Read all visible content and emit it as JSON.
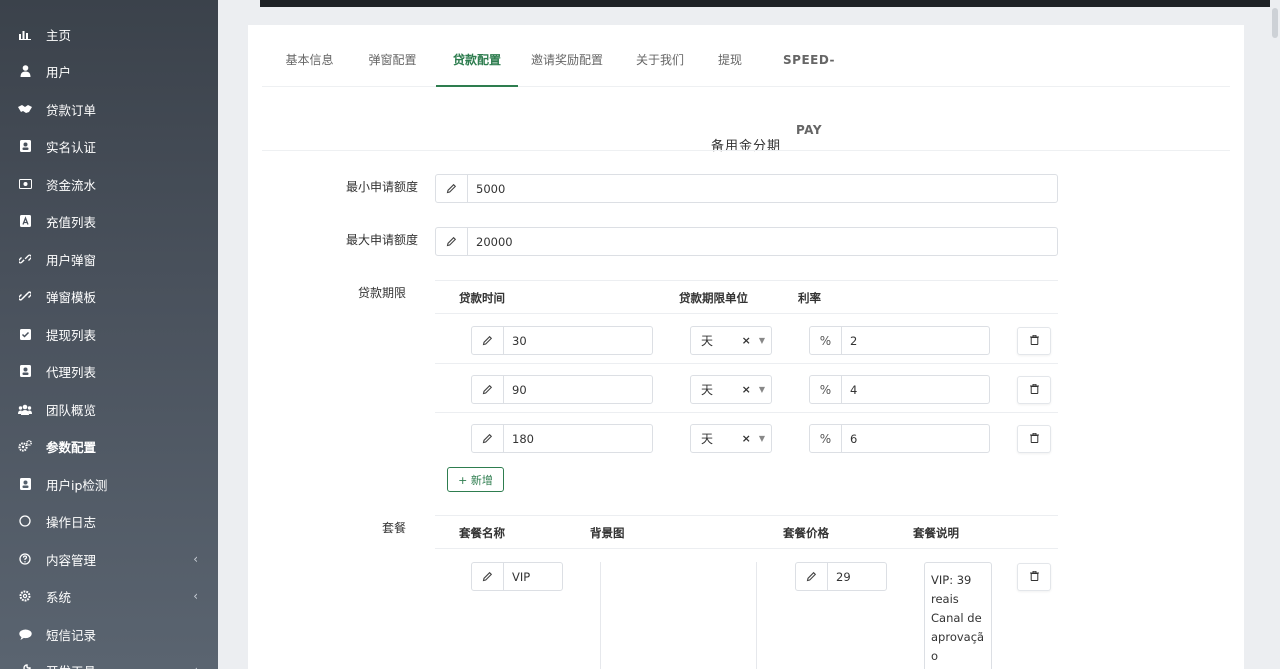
{
  "sidebar": {
    "items": [
      {
        "label": "主页",
        "icon": "bar-chart-icon"
      },
      {
        "label": "用户",
        "icon": "user-icon"
      },
      {
        "label": "贷款订单",
        "icon": "handshake-icon"
      },
      {
        "label": "实名认证",
        "icon": "id-card-icon"
      },
      {
        "label": "资金流水",
        "icon": "money-icon"
      },
      {
        "label": "充值列表",
        "icon": "app-store-icon"
      },
      {
        "label": "用户弹窗",
        "icon": "link-icon"
      },
      {
        "label": "弹窗模板",
        "icon": "link-icon"
      },
      {
        "label": "提现列表",
        "icon": "checkbox-icon"
      },
      {
        "label": "代理列表",
        "icon": "id-card-icon"
      },
      {
        "label": "团队概览",
        "icon": "users-icon"
      },
      {
        "label": "参数配置",
        "icon": "cogs-icon"
      },
      {
        "label": "用户ip检测",
        "icon": "id-card-icon"
      },
      {
        "label": "操作日志",
        "icon": "circle-icon"
      },
      {
        "label": "内容管理",
        "icon": "question-circle-icon",
        "chevron": "‹"
      },
      {
        "label": "系统",
        "icon": "gear-icon",
        "chevron": "‹"
      },
      {
        "label": "短信记录",
        "icon": "comment-icon"
      },
      {
        "label": "开发工具",
        "icon": "wrench-icon",
        "chevron": "‹"
      }
    ],
    "active_index": 11
  },
  "tabs": [
    {
      "label": "基本信息"
    },
    {
      "label": "弹窗配置"
    },
    {
      "label": "贷款配置"
    },
    {
      "label": "邀请奖励配置"
    },
    {
      "label": "关于我们"
    },
    {
      "label": "提现"
    },
    {
      "label": "SPEED-PAY"
    }
  ],
  "active_tab": "贷款配置",
  "section_title": "备用金分期",
  "min_amount": {
    "label": "最小申请额度",
    "value": "5000"
  },
  "max_amount": {
    "label": "最大申请额度",
    "value": "20000"
  },
  "loan_term": {
    "label": "贷款期限",
    "headers": {
      "time": "贷款时间",
      "unit": "贷款期限单位",
      "rate": "利率"
    },
    "rows": [
      {
        "time": "30",
        "unit": "天",
        "rate_prefix": "%",
        "rate": "2"
      },
      {
        "time": "90",
        "unit": "天",
        "rate_prefix": "%",
        "rate": "4"
      },
      {
        "time": "180",
        "unit": "天",
        "rate_prefix": "%",
        "rate": "6"
      }
    ],
    "add_label": "+ 新增"
  },
  "package": {
    "label": "套餐",
    "headers": {
      "name": "套餐名称",
      "bg": "背景图",
      "price": "套餐价格",
      "desc": "套餐说明"
    },
    "rows": [
      {
        "name": "VIP",
        "price": "29",
        "desc": "VIP: 39 reais Canal de aprovação"
      }
    ]
  },
  "colors": {
    "accent": "#2e7d4f",
    "sidebar_top": "#3b424b",
    "sidebar_bottom": "#5a6470"
  }
}
